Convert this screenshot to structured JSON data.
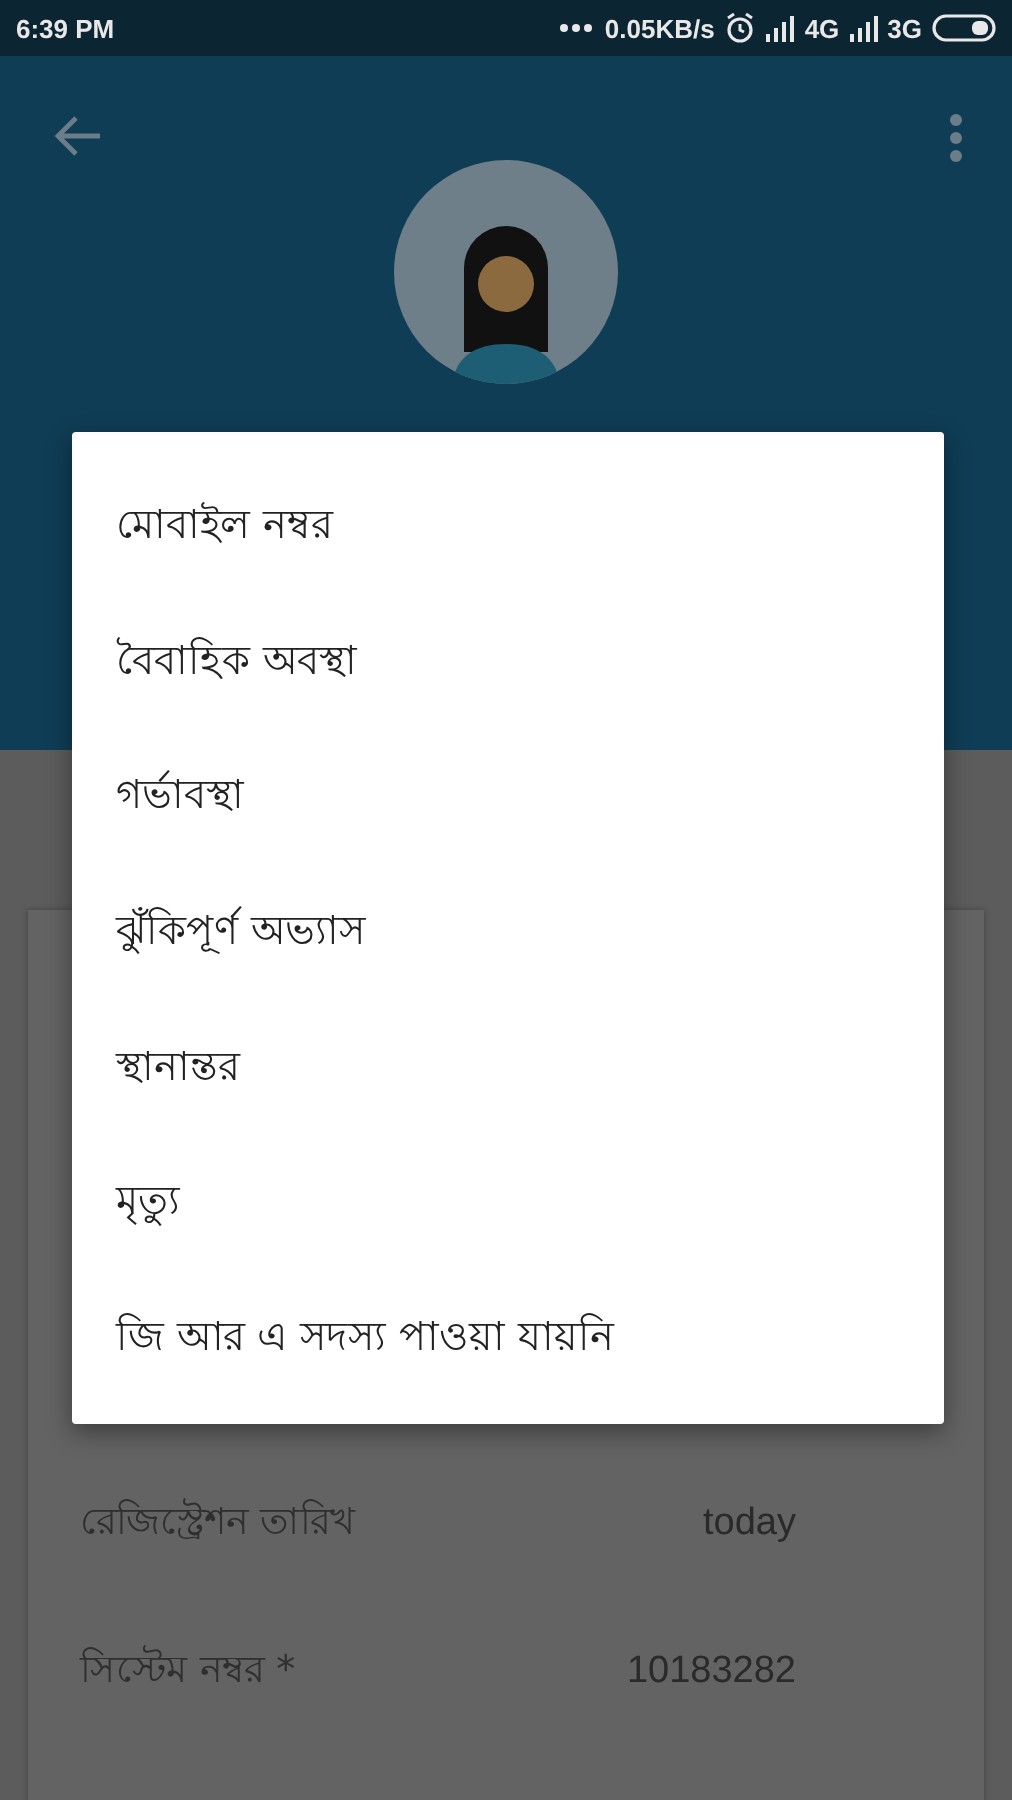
{
  "status_bar": {
    "time": "6:39 PM",
    "speed": "0.05KB/s",
    "network_1": "4G",
    "network_2": "3G"
  },
  "fields": [
    {
      "label": "রেজিস্ট্রেশন তারিখ",
      "value": "today"
    },
    {
      "label": "সিস্টেম নম্বর *",
      "value": "10183282"
    }
  ],
  "menu": {
    "items": [
      "মোবাইল নম্বর",
      "বৈবাহিক অবস্থা",
      "গর্ভাবস্থা",
      "ঝুঁকিপূর্ণ অভ্যাস",
      "স্থানান্তর",
      "মৃত্যু",
      "জি আর এ সদস্য পাওয়া যায়নি"
    ]
  }
}
